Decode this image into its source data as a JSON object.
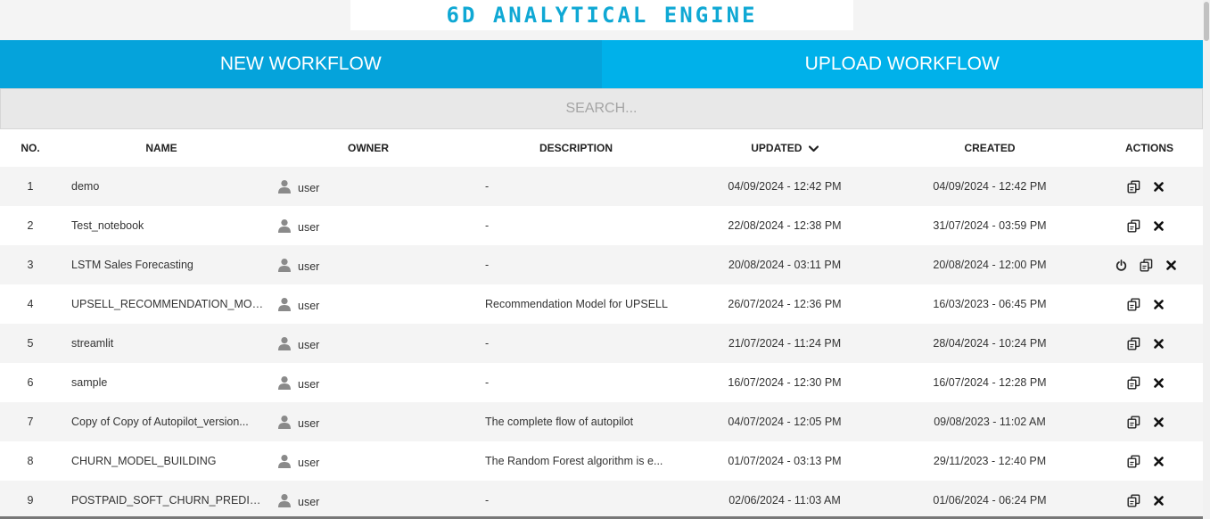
{
  "header": {
    "logo_text": "6D ANALYTICAL ENGINE"
  },
  "tabs": [
    {
      "label": "NEW WORKFLOW"
    },
    {
      "label": "UPLOAD WORKFLOW"
    }
  ],
  "search": {
    "placeholder": "SEARCH..."
  },
  "table": {
    "columns": {
      "no": "NO.",
      "name": "NAME",
      "owner": "OWNER",
      "description": "DESCRIPTION",
      "updated": "UPDATED",
      "created": "CREATED",
      "actions": "ACTIONS"
    },
    "sorted_by": "updated",
    "rows": [
      {
        "no": "1",
        "name": "demo",
        "owner": "user",
        "description": "-",
        "updated": "04/09/2024 - 12:42 PM",
        "created": "04/09/2024 - 12:42 PM",
        "actions": [
          "copy-icon",
          "close-icon"
        ]
      },
      {
        "no": "2",
        "name": "Test_notebook",
        "owner": "user",
        "description": "-",
        "updated": "22/08/2024 - 12:38 PM",
        "created": "31/07/2024 - 03:59 PM",
        "actions": [
          "copy-icon",
          "close-icon"
        ]
      },
      {
        "no": "3",
        "name": "LSTM Sales Forecasting",
        "owner": "user",
        "description": "-",
        "updated": "20/08/2024 - 03:11 PM",
        "created": "20/08/2024 - 12:00 PM",
        "actions": [
          "power-icon",
          "copy-icon",
          "close-icon"
        ]
      },
      {
        "no": "4",
        "name": "UPSELL_RECOMMENDATION_MOD...",
        "owner": "user",
        "description": "Recommendation Model for UPSELL",
        "updated": "26/07/2024 - 12:36 PM",
        "created": "16/03/2023 - 06:45 PM",
        "actions": [
          "copy-icon",
          "close-icon"
        ]
      },
      {
        "no": "5",
        "name": "streamlit",
        "owner": "user",
        "description": "-",
        "updated": "21/07/2024 - 11:24 PM",
        "created": "28/04/2024 - 10:24 PM",
        "actions": [
          "copy-icon",
          "close-icon"
        ]
      },
      {
        "no": "6",
        "name": "sample",
        "owner": "user",
        "description": "-",
        "updated": "16/07/2024 - 12:30 PM",
        "created": "16/07/2024 - 12:28 PM",
        "actions": [
          "copy-icon",
          "close-icon"
        ]
      },
      {
        "no": "7",
        "name": "Copy of Copy of Autopilot_version...",
        "owner": "user",
        "description": "The complete flow of autopilot",
        "updated": "04/07/2024 - 12:05 PM",
        "created": "09/08/2023 - 11:02 AM",
        "actions": [
          "copy-icon",
          "close-icon"
        ]
      },
      {
        "no": "8",
        "name": "CHURN_MODEL_BUILDING",
        "owner": "user",
        "description": "The Random Forest algorithm is e...",
        "updated": "01/07/2024 - 03:13 PM",
        "created": "29/11/2023 - 12:40 PM",
        "actions": [
          "copy-icon",
          "close-icon"
        ]
      },
      {
        "no": "9",
        "name": "POSTPAID_SOFT_CHURN_PREDICIT...",
        "owner": "user",
        "description": "-",
        "updated": "02/06/2024 - 11:03 AM",
        "created": "01/06/2024 - 06:24 PM",
        "actions": [
          "copy-icon",
          "close-icon"
        ]
      }
    ]
  },
  "colors": {
    "brand": "#0fa8d4",
    "tab_new": "#05a3db",
    "tab_upload": "#00b1ea",
    "row_alt": "#f4f4f4",
    "owner_icon": "#8a8a8a"
  }
}
